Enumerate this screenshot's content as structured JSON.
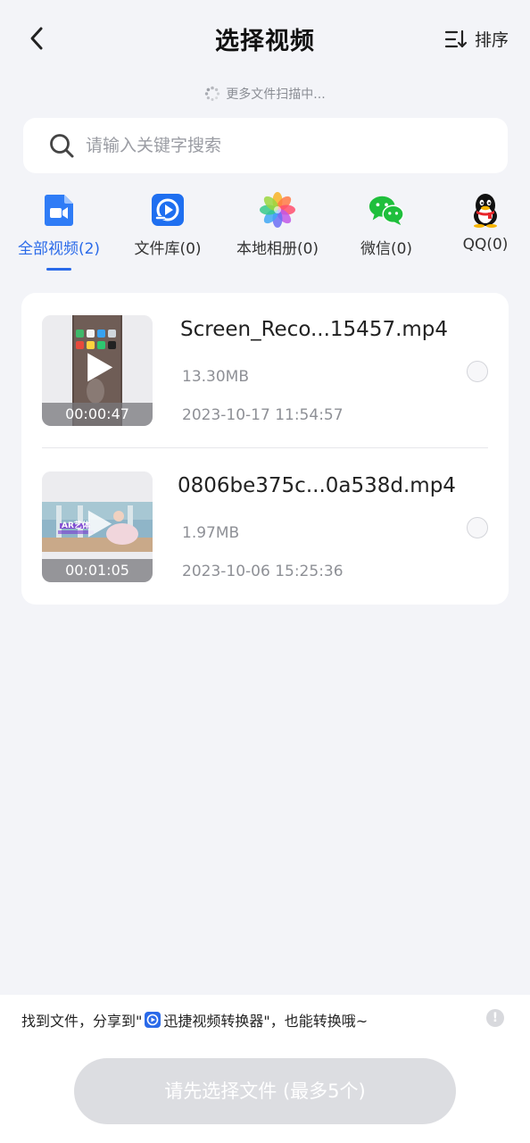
{
  "header": {
    "title": "选择视频",
    "sort_label": "排序"
  },
  "scan_status": "更多文件扫描中...",
  "search": {
    "placeholder": "请输入关键字搜索"
  },
  "tabs": [
    {
      "label": "全部视频(2)",
      "icon": "video-camera-icon",
      "active": true
    },
    {
      "label": "文件库(0)",
      "icon": "file-library-icon",
      "active": false
    },
    {
      "label": "本地相册(0)",
      "icon": "photos-flower-icon",
      "active": false
    },
    {
      "label": "微信(0)",
      "icon": "wechat-icon",
      "active": false
    },
    {
      "label": "QQ(0)",
      "icon": "qq-penguin-icon",
      "active": false
    }
  ],
  "files": [
    {
      "name": "Screen_Reco...15457.mp4",
      "size": "13.30MB",
      "date": "2023-10-17 11:54:57",
      "duration": "00:00:47"
    },
    {
      "name": "0806be375c...0a538d.mp4",
      "size": "1.97MB",
      "date": "2023-10-06 15:25:36",
      "duration": "00:01:05",
      "thumb_text": "AR艺体"
    }
  ],
  "bottom": {
    "hint_prefix": "找到文件，分享到\"",
    "hint_app": "迅捷视频转换器",
    "hint_suffix": "\"，也能转换哦~",
    "button_label": "请先选择文件 (最多5个)"
  },
  "colors": {
    "accent": "#2a6ae9",
    "background": "#f3f4f8",
    "button_disabled": "#dcdde1"
  }
}
